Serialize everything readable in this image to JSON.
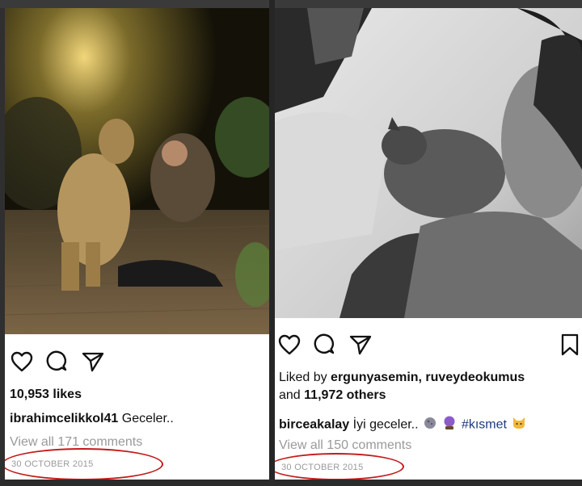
{
  "left_post": {
    "likes": "10,953 likes",
    "caption_user": "ibrahimcelikkol41",
    "caption_text": "Geceler..",
    "comments_link": "View all 171 comments",
    "date": "30 OCTOBER 2015",
    "icons": [
      "heart-icon",
      "comment-icon",
      "share-icon"
    ]
  },
  "right_post": {
    "liked_prefix": "Liked by",
    "liked_users": "ergunyasemin, ruveydeokumus",
    "liked_and": "and",
    "liked_others": "11,972 others",
    "caption_user": "birceakalay",
    "caption_text": "İyi geceler..",
    "hashtag": "#kısmet",
    "comments_link": "View all 150 comments",
    "date": "30 OCTOBER 2015",
    "icons": [
      "heart-icon",
      "comment-icon",
      "share-icon",
      "bookmark-icon"
    ]
  }
}
